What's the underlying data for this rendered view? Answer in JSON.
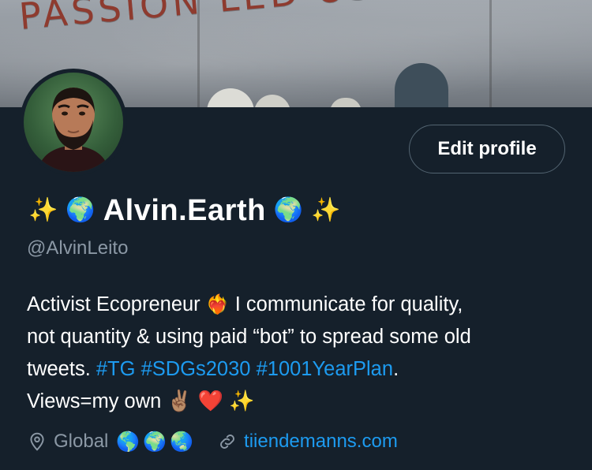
{
  "banner": {
    "text": "PASSION LED US H"
  },
  "header": {
    "edit_profile_label": "Edit profile"
  },
  "profile": {
    "name_prefix_emoji": [
      "✨",
      "🌍"
    ],
    "display_name": "Alvin.Earth",
    "name_suffix_emoji": [
      "🌍",
      "✨"
    ],
    "handle": "@AlvinLeito",
    "bio": {
      "line1_text": "Activist Ecopreneur ",
      "line1_emoji": "❤️‍🔥",
      "line1_rest": " I communicate for quality,",
      "line2": "not quantity & using paid “bot” to spread some old",
      "line3_prefix": "tweets. ",
      "hashtags": [
        "#TG",
        "#SDGs2030",
        "#1001YearPlan"
      ],
      "line3_suffix": ".",
      "line4_text": "Views=my own ",
      "line4_emoji": [
        "✌🏽",
        "❤️",
        "✨"
      ]
    },
    "location": "Global",
    "location_emoji": [
      "🌎",
      "🌍",
      "🌏"
    ],
    "website": "tiiendemanns.com"
  },
  "icons": {
    "location": "location-pin-icon",
    "link": "link-icon"
  },
  "colors": {
    "background": "#15202b",
    "accent": "#1d9bf0",
    "secondary_text": "#8b98a5",
    "button_border": "#536471"
  }
}
